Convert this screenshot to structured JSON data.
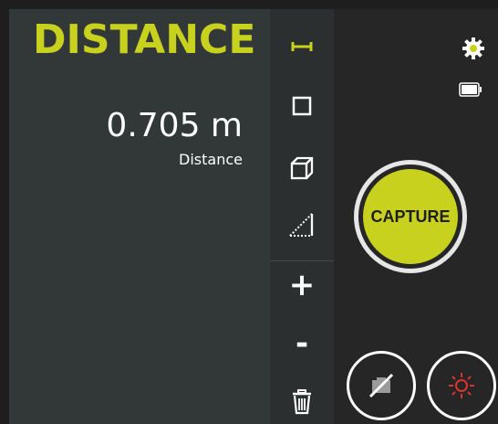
{
  "mode": {
    "title": "DISTANCE"
  },
  "measurement": {
    "value": "0.705 m",
    "label": "Distance"
  },
  "tools": [
    {
      "icon": "distance-tool-icon",
      "active": true
    },
    {
      "icon": "area-tool-icon",
      "active": false
    },
    {
      "icon": "volume-tool-icon",
      "active": false
    },
    {
      "icon": "angle-tool-icon",
      "active": false
    },
    {
      "icon": "add-icon",
      "label": "+"
    },
    {
      "icon": "minus-icon",
      "label": "-"
    },
    {
      "icon": "trash-icon"
    }
  ],
  "capture": {
    "label": "CAPTURE"
  },
  "status": {
    "battery_icon": "battery-icon",
    "settings_icon": "gear-icon"
  },
  "colors": {
    "accent": "#c8d21e",
    "panel": "#323838",
    "light_button": "#e0332b"
  }
}
